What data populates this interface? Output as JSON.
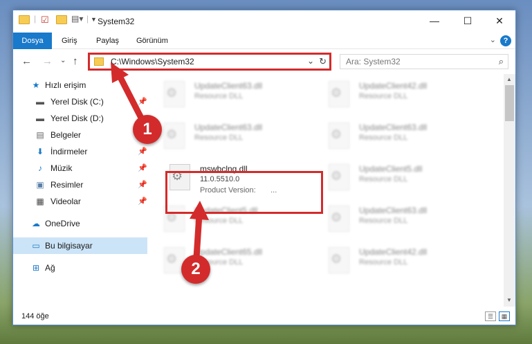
{
  "window": {
    "title": "System32",
    "minimize": "—",
    "maximize": "☐",
    "close": "✕"
  },
  "ribbon": {
    "tabs": [
      "Dosya",
      "Giriş",
      "Paylaş",
      "Görünüm"
    ],
    "help": "?"
  },
  "nav": {
    "address": "C:\\Windows\\System32",
    "search_placeholder": "Ara: System32"
  },
  "sidebar": {
    "items": [
      {
        "label": "Hızlı erişim",
        "icon": "star-icon"
      },
      {
        "label": "Yerel Disk (C:)",
        "icon": "drive-icon"
      },
      {
        "label": "Yerel Disk (D:)",
        "icon": "drive-icon"
      },
      {
        "label": "Belgeler",
        "icon": "documents-icon"
      },
      {
        "label": "İndirmeler",
        "icon": "download-icon"
      },
      {
        "label": "Müzik",
        "icon": "music-icon"
      },
      {
        "label": "Resimler",
        "icon": "pictures-icon"
      },
      {
        "label": "Videolar",
        "icon": "videos-icon"
      },
      {
        "label": "OneDrive",
        "icon": "cloud-icon"
      },
      {
        "label": "Bu bilgisayar",
        "icon": "computer-icon"
      },
      {
        "label": "Ağ",
        "icon": "network-icon"
      }
    ]
  },
  "files": [
    {
      "name": "UpdateClient63.dll",
      "type": "Resource DLL"
    },
    {
      "name": "UpdateClient42.dll",
      "type": "Resource DLL"
    },
    {
      "name": "UpdateClient63.dll",
      "type": "Resource DLL"
    },
    {
      "name": "UpdateClient63.dll",
      "type": "Resource DLL"
    },
    {
      "name": "UpdateClient5.dll",
      "type": "Resource DLL"
    },
    {
      "name": "UpdateClient5.dll",
      "type": "Resource DLL"
    },
    {
      "name": "UpdateClient63.dll",
      "type": "Resource DLL"
    },
    {
      "name": "UpdateClient65.dll",
      "type": "Resource DLL"
    },
    {
      "name": "UpdateClient42.dll",
      "type": "Resource DLL"
    }
  ],
  "highlighted_file": {
    "name": "mswbclng.dll",
    "version": "11.0.5510.0",
    "product_version_label": "Product Version:",
    "product_version_value": "..."
  },
  "status": {
    "item_count": "144 öğe"
  },
  "annotations": {
    "step1": "1",
    "step2": "2",
    "color": "#d32b2b"
  }
}
